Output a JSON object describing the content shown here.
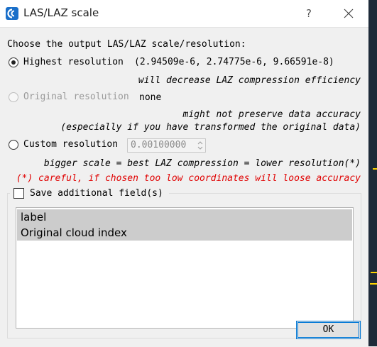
{
  "window": {
    "title": "LAS/LAZ scale",
    "help_label": "?",
    "accent_color": "#0078d7"
  },
  "prompt": "Choose the output LAS/LAZ scale/resolution:",
  "highest": {
    "label": "Highest resolution",
    "value": "(2.94509e-6, 2.74775e-6, 9.66591e-8)",
    "note": "will decrease LAZ compression efficiency",
    "checked": true
  },
  "original": {
    "label": "Original resolution",
    "value": "none",
    "note1": "might not preserve data accuracy",
    "note2": "(especially if you have transformed the original data)",
    "enabled": false
  },
  "custom": {
    "label": "Custom resolution",
    "value": "0.00100000",
    "note": "bigger scale = best LAZ compression = lower resolution(*)",
    "warning": "(*) careful, if chosen too low coordinates will loose accuracy",
    "warning_color": "#e00000"
  },
  "extra_fields": {
    "label": "Save additional field(s)",
    "checked": false,
    "items": [
      "label",
      "Original cloud index"
    ]
  },
  "buttons": {
    "ok_label": "OK"
  }
}
